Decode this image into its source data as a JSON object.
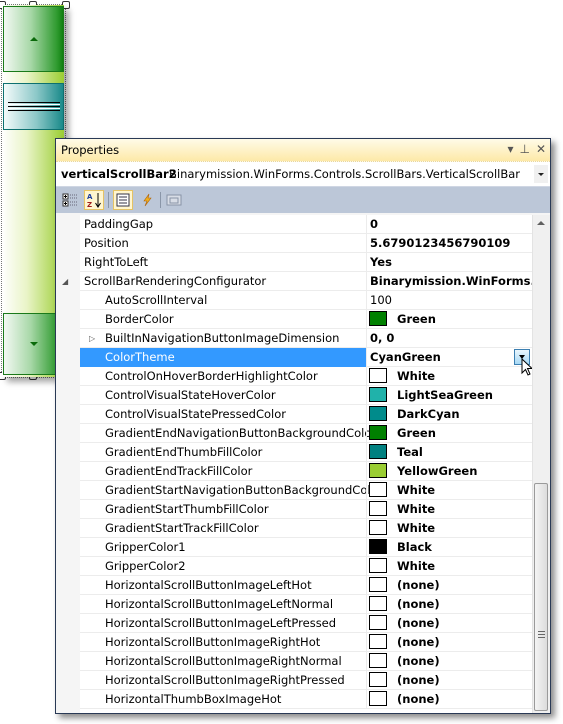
{
  "props_window": {
    "title": "Properties",
    "title_icons": [
      "dropdown-arrow",
      "pin",
      "close"
    ],
    "title_icon_glyphs": [
      "▾",
      "⊥",
      "✕"
    ],
    "object_name": "verticalScrollBar2",
    "object_type": "Binarymission.WinForms.Controls.ScrollBars.VerticalScrollBar",
    "toolbar": {
      "categorized": "Categorized",
      "alphabetical": "Alphabetical",
      "properties": "Properties",
      "events": "Events",
      "property_pages": "Property Pages"
    }
  },
  "properties": [
    {
      "name": "PaddingGap",
      "value": "0",
      "bold": true
    },
    {
      "name": "Position",
      "value": "5.6790123456790109",
      "bold": true
    },
    {
      "name": "RightToLeft",
      "value": "Yes",
      "bold": true
    },
    {
      "name": "ScrollBarRenderingConfigurator",
      "value": "Binarymission.WinForms.Controls.ScrollBars.ScrollBarRenderingConfigurator",
      "bold": true,
      "expanded": true
    },
    {
      "name": "AutoScrollInterval",
      "value": "100",
      "bold": false,
      "child": true
    },
    {
      "name": "BorderColor",
      "value": "Green",
      "bold": true,
      "child": true,
      "swatch": "#008000"
    },
    {
      "name": "BuiltInNavigationButtonImageDimension",
      "value": "0, 0",
      "bold": true,
      "child": true,
      "collapsed": true
    },
    {
      "name": "ColorTheme",
      "value": "CyanGreen",
      "bold": true,
      "child": true,
      "selected": true
    },
    {
      "name": "ControlOnHoverBorderHighlightColor",
      "value": "White",
      "bold": true,
      "child": true,
      "swatch": "#ffffff"
    },
    {
      "name": "ControlVisualStateHoverColor",
      "value": "LightSeaGreen",
      "bold": true,
      "child": true,
      "swatch": "#20b2aa"
    },
    {
      "name": "ControlVisualStatePressedColor",
      "value": "DarkCyan",
      "bold": true,
      "child": true,
      "swatch": "#008b8b"
    },
    {
      "name": "GradientEndNavigationButtonBackgroundColor",
      "value": "Green",
      "bold": true,
      "child": true,
      "swatch": "#008000"
    },
    {
      "name": "GradientEndThumbFillColor",
      "value": "Teal",
      "bold": true,
      "child": true,
      "swatch": "#008080"
    },
    {
      "name": "GradientEndTrackFillColor",
      "value": "YellowGreen",
      "bold": true,
      "child": true,
      "swatch": "#9acd32"
    },
    {
      "name": "GradientStartNavigationButtonBackgroundColor",
      "value": "White",
      "bold": true,
      "child": true,
      "swatch": "#ffffff"
    },
    {
      "name": "GradientStartThumbFillColor",
      "value": "White",
      "bold": true,
      "child": true,
      "swatch": "#ffffff"
    },
    {
      "name": "GradientStartTrackFillColor",
      "value": "White",
      "bold": true,
      "child": true,
      "swatch": "#ffffff"
    },
    {
      "name": "GripperColor1",
      "value": "Black",
      "bold": true,
      "child": true,
      "swatch": "#000000"
    },
    {
      "name": "GripperColor2",
      "value": "White",
      "bold": true,
      "child": true,
      "swatch": "#ffffff"
    },
    {
      "name": "HorizontalScrollButtonImageLeftHot",
      "value": "(none)",
      "bold": true,
      "child": true,
      "swatch": "#ffffff"
    },
    {
      "name": "HorizontalScrollButtonImageLeftNormal",
      "value": "(none)",
      "bold": true,
      "child": true,
      "swatch": "#ffffff"
    },
    {
      "name": "HorizontalScrollButtonImageLeftPressed",
      "value": "(none)",
      "bold": true,
      "child": true,
      "swatch": "#ffffff"
    },
    {
      "name": "HorizontalScrollButtonImageRightHot",
      "value": "(none)",
      "bold": true,
      "child": true,
      "swatch": "#ffffff"
    },
    {
      "name": "HorizontalScrollButtonImageRightNormal",
      "value": "(none)",
      "bold": true,
      "child": true,
      "swatch": "#ffffff"
    },
    {
      "name": "HorizontalScrollButtonImageRightPressed",
      "value": "(none)",
      "bold": true,
      "child": true,
      "swatch": "#ffffff"
    },
    {
      "name": "HorizontalThumbBoxImageHot",
      "value": "(none)",
      "bold": true,
      "child": true,
      "swatch": "#ffffff"
    }
  ],
  "colors": {
    "selection": "#3399ff",
    "toolbar_bg": "#bcc7d8",
    "title_bg": "#fde9a8",
    "frame": "#293955"
  }
}
